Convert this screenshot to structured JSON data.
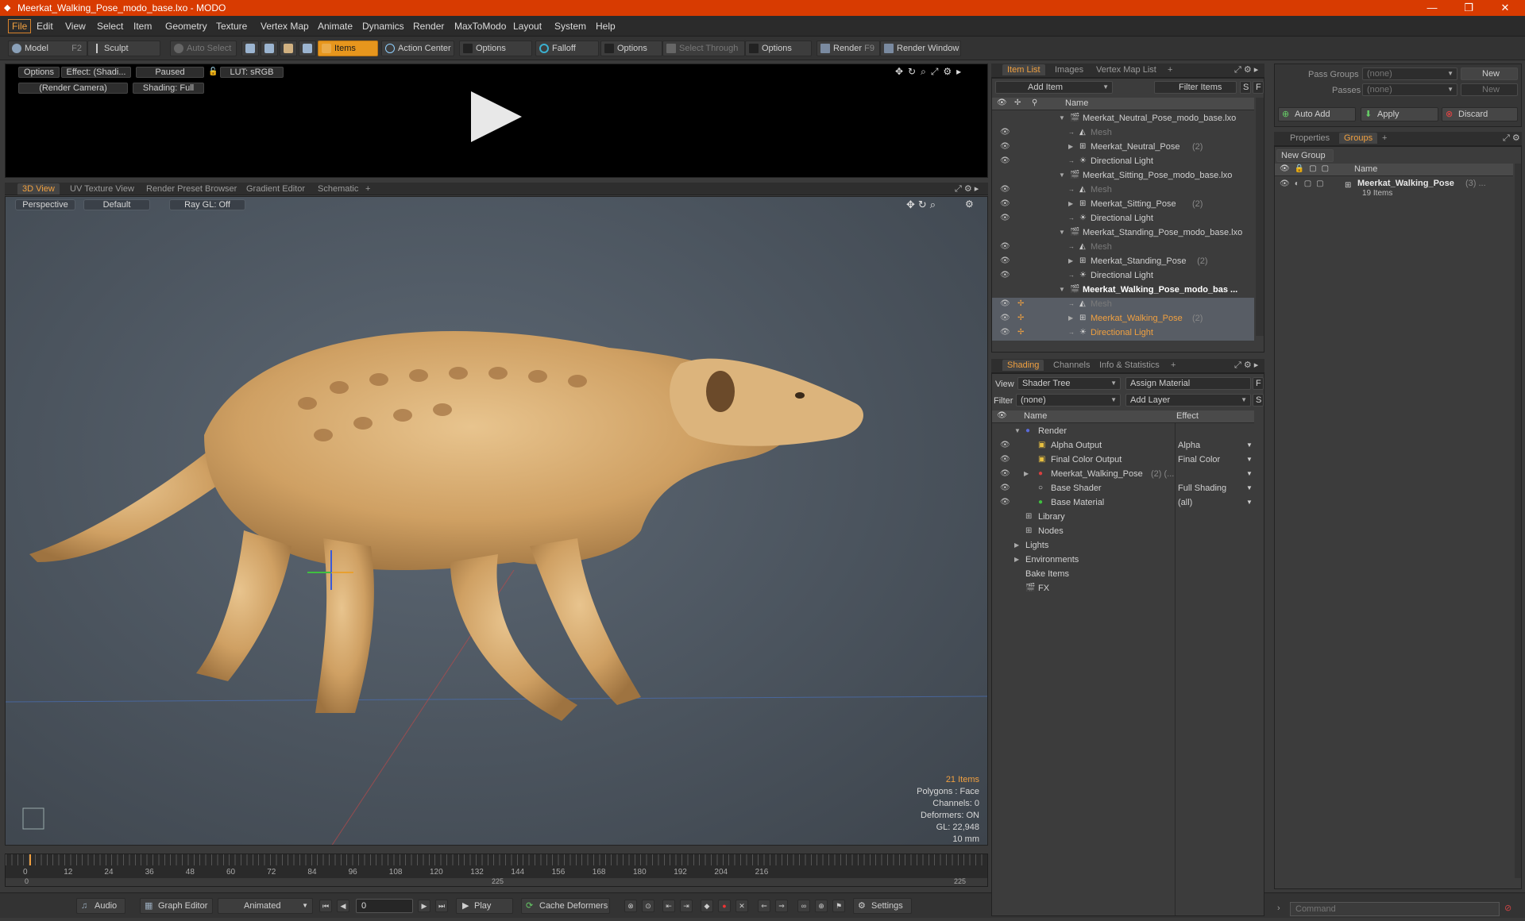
{
  "window": {
    "title": "Meerkat_Walking_Pose_modo_base.lxo - MODO"
  },
  "menu": [
    "File",
    "Edit",
    "View",
    "Select",
    "Item",
    "Geometry",
    "Texture",
    "Vertex Map",
    "Animate",
    "Dynamics",
    "Render",
    "MaxToModo",
    "Layout",
    "System",
    "Help"
  ],
  "toolbar": {
    "model": "Model",
    "model_key": "F2",
    "sculpt": "Sculpt",
    "auto_select": "Auto Select",
    "items": "Items",
    "action_center": "Action Center",
    "options1": "Options",
    "falloff": "Falloff",
    "options2": "Options",
    "select_through": "Select Through",
    "options3": "Options",
    "render": "Render",
    "render_key": "F9",
    "render_window": "Render Window"
  },
  "preview": {
    "options": "Options",
    "effect": "Effect: (Shadi...",
    "paused": "Paused",
    "lut": "LUT: sRGB",
    "camera": "(Render Camera)",
    "shading": "Shading: Full"
  },
  "viewtabs": [
    "3D View",
    "UV Texture View",
    "Render Preset Browser",
    "Gradient Editor",
    "Schematic",
    "+"
  ],
  "view3d": {
    "perspective": "Perspective",
    "default": "Default",
    "raygl": "Ray GL: Off",
    "stats": {
      "items": "21 Items",
      "polygons": "Polygons : Face",
      "channels": "Channels: 0",
      "deformers": "Deformers: ON",
      "gl": "GL: 22,948",
      "unit": "10 mm"
    }
  },
  "timeline": {
    "ticks": [
      "0",
      "12",
      "24",
      "36",
      "48",
      "60",
      "72",
      "84",
      "96",
      "108",
      "120",
      "132",
      "144",
      "156",
      "168",
      "180",
      "192",
      "204",
      "216"
    ],
    "range_start": "0",
    "range_mid": "225",
    "range_end": "225"
  },
  "bottombar": {
    "audio": "Audio",
    "graph_editor": "Graph Editor",
    "animated": "Animated",
    "frame": "0",
    "play": "Play",
    "cache": "Cache Deformers",
    "settings": "Settings"
  },
  "itemlist": {
    "tabs": [
      "Item List",
      "Images",
      "Vertex Map List",
      "+"
    ],
    "add_item": "Add Item",
    "filter": "Filter Items",
    "s": "S",
    "f": "F",
    "col_name": "Name",
    "rows": [
      {
        "label": "Meerkat_Neutral_Pose_modo_base.lxo",
        "indent": 0,
        "style": "scene"
      },
      {
        "label": "Mesh",
        "indent": 1,
        "style": "faded"
      },
      {
        "label": "Meerkat_Neutral_Pose",
        "count": "(2)",
        "indent": 1,
        "style": "group"
      },
      {
        "label": "Directional Light",
        "indent": 1,
        "style": "normal"
      },
      {
        "label": "Meerkat_Sitting_Pose_modo_base.lxo",
        "indent": 0,
        "style": "scene"
      },
      {
        "label": "Mesh",
        "indent": 1,
        "style": "faded"
      },
      {
        "label": "Meerkat_Sitting_Pose",
        "count": "(2)",
        "indent": 1,
        "style": "group"
      },
      {
        "label": "Directional Light",
        "indent": 1,
        "style": "normal"
      },
      {
        "label": "Meerkat_Standing_Pose_modo_base.lxo",
        "indent": 0,
        "style": "scene"
      },
      {
        "label": "Mesh",
        "indent": 1,
        "style": "faded"
      },
      {
        "label": "Meerkat_Standing_Pose",
        "count": "(2)",
        "indent": 1,
        "style": "group"
      },
      {
        "label": "Directional Light",
        "indent": 1,
        "style": "normal"
      },
      {
        "label": "Meerkat_Walking_Pose_modo_bas ...",
        "indent": 0,
        "style": "scene-bold"
      },
      {
        "label": "Mesh",
        "indent": 1,
        "style": "faded-sel"
      },
      {
        "label": "Meerkat_Walking_Pose",
        "count": "(2)",
        "indent": 1,
        "style": "orange"
      },
      {
        "label": "Directional Light",
        "indent": 1,
        "style": "orange"
      }
    ]
  },
  "shading": {
    "tabs": [
      "Shading",
      "Channels",
      "Info & Statistics",
      "+"
    ],
    "view_label": "View",
    "view_value": "Shader Tree",
    "assign": "Assign Material",
    "f": "F",
    "filter_label": "Filter",
    "filter_value": "(none)",
    "add_layer": "Add Layer",
    "s": "S",
    "col_name": "Name",
    "col_effect": "Effect",
    "rows": [
      {
        "label": "Render",
        "effect": "",
        "indent": 0
      },
      {
        "label": "Alpha Output",
        "effect": "Alpha",
        "indent": 1
      },
      {
        "label": "Final Color Output",
        "effect": "Final Color",
        "indent": 1
      },
      {
        "label": "Meerkat_Walking_Pose",
        "count": "(2) (...",
        "effect": "",
        "indent": 1
      },
      {
        "label": "Base Shader",
        "effect": "Full Shading",
        "indent": 1
      },
      {
        "label": "Base Material",
        "effect": "(all)",
        "indent": 1
      },
      {
        "label": "Library",
        "effect": "",
        "indent": 0
      },
      {
        "label": "Nodes",
        "effect": "",
        "indent": 0
      },
      {
        "label": "Lights",
        "effect": "",
        "indent": 0
      },
      {
        "label": "Environments",
        "effect": "",
        "indent": 0
      },
      {
        "label": "Bake Items",
        "effect": "",
        "indent": 0
      },
      {
        "label": "FX",
        "effect": "",
        "indent": 0
      }
    ]
  },
  "groups": {
    "pass_groups_label": "Pass Groups",
    "pass_groups_value": "(none)",
    "new1": "New",
    "passes_label": "Passes",
    "passes_value": "(none)",
    "new2": "New",
    "auto_add": "Auto Add",
    "apply": "Apply",
    "discard": "Discard",
    "tabs": [
      "Properties",
      "Groups",
      "+"
    ],
    "new_group": "New Group",
    "col_name": "Name",
    "group_name": "Meerkat_Walking_Pose",
    "group_count": "(3) ...",
    "group_items": "19 Items"
  },
  "command": {
    "placeholder": "Command"
  },
  "colors": {
    "accent": "#e7961d",
    "titlebar": "#d83b01"
  }
}
